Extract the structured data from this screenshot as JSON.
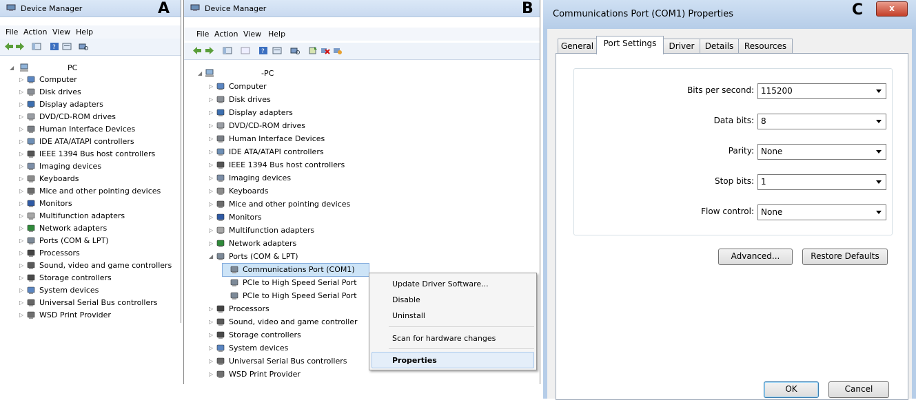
{
  "panelA": {
    "letter": "A",
    "window_title": "Device Manager",
    "menu": [
      "File",
      "Action",
      "View",
      "Help"
    ],
    "root_label": "PC",
    "tree": [
      {
        "label": "Computer",
        "icon": "computer-icon"
      },
      {
        "label": "Disk drives",
        "icon": "disk-drive-icon"
      },
      {
        "label": "Display adapters",
        "icon": "display-adapter-icon"
      },
      {
        "label": "DVD/CD-ROM drives",
        "icon": "dvd-drive-icon"
      },
      {
        "label": "Human Interface Devices",
        "icon": "hid-icon"
      },
      {
        "label": "IDE ATA/ATAPI controllers",
        "icon": "ide-controller-icon"
      },
      {
        "label": "IEEE 1394 Bus host controllers",
        "icon": "ieee1394-icon"
      },
      {
        "label": "Imaging devices",
        "icon": "imaging-device-icon"
      },
      {
        "label": "Keyboards",
        "icon": "keyboard-icon"
      },
      {
        "label": "Mice and other pointing devices",
        "icon": "mouse-icon"
      },
      {
        "label": "Monitors",
        "icon": "monitor-icon"
      },
      {
        "label": "Multifunction adapters",
        "icon": "multifunction-icon"
      },
      {
        "label": "Network adapters",
        "icon": "network-adapter-icon"
      },
      {
        "label": "Ports (COM & LPT)",
        "icon": "port-icon"
      },
      {
        "label": "Processors",
        "icon": "processor-icon"
      },
      {
        "label": "Sound, video and game controllers",
        "icon": "sound-icon"
      },
      {
        "label": "Storage controllers",
        "icon": "storage-controller-icon"
      },
      {
        "label": "System devices",
        "icon": "system-device-icon"
      },
      {
        "label": "Universal Serial Bus controllers",
        "icon": "usb-icon"
      },
      {
        "label": "WSD Print Provider",
        "icon": "printer-icon"
      }
    ]
  },
  "panelB": {
    "letter": "B",
    "window_title": "Device Manager",
    "menu": [
      "File",
      "Action",
      "View",
      "Help"
    ],
    "root_label": "-PC",
    "tree_before": [
      {
        "label": "Computer",
        "icon": "computer-icon"
      },
      {
        "label": "Disk drives",
        "icon": "disk-drive-icon"
      },
      {
        "label": "Display adapters",
        "icon": "display-adapter-icon"
      },
      {
        "label": "DVD/CD-ROM drives",
        "icon": "dvd-drive-icon"
      },
      {
        "label": "Human Interface Devices",
        "icon": "hid-icon"
      },
      {
        "label": "IDE ATA/ATAPI controllers",
        "icon": "ide-controller-icon"
      },
      {
        "label": "IEEE 1394 Bus host controllers",
        "icon": "ieee1394-icon"
      },
      {
        "label": "Imaging devices",
        "icon": "imaging-device-icon"
      },
      {
        "label": "Keyboards",
        "icon": "keyboard-icon"
      },
      {
        "label": "Mice and other pointing devices",
        "icon": "mouse-icon"
      },
      {
        "label": "Monitors",
        "icon": "monitor-icon"
      },
      {
        "label": "Multifunction adapters",
        "icon": "multifunction-icon"
      },
      {
        "label": "Network adapters",
        "icon": "network-adapter-icon"
      },
      {
        "label": "Ports (COM & LPT)",
        "icon": "port-icon"
      }
    ],
    "ports_children": [
      {
        "label": "Communications Port (COM1)"
      },
      {
        "label": "PCIe to High Speed Serial Port"
      },
      {
        "label": "PCIe to High Speed Serial Port"
      }
    ],
    "tree_after": [
      {
        "label": "Processors",
        "icon": "processor-icon"
      },
      {
        "label": "Sound, video and game controller",
        "icon": "sound-icon"
      },
      {
        "label": "Storage controllers",
        "icon": "storage-controller-icon"
      },
      {
        "label": "System devices",
        "icon": "system-device-icon"
      },
      {
        "label": "Universal Serial Bus controllers",
        "icon": "usb-icon"
      },
      {
        "label": "WSD Print Provider",
        "icon": "printer-icon"
      }
    ],
    "context_menu": {
      "update_driver": "Update Driver Software...",
      "disable": "Disable",
      "uninstall": "Uninstall",
      "scan": "Scan for hardware changes",
      "properties": "Properties"
    }
  },
  "panelC": {
    "letter": "C",
    "window_title": "Communications Port (COM1) Properties",
    "close_glyph": "x",
    "tabs": [
      "General",
      "Port Settings",
      "Driver",
      "Details",
      "Resources"
    ],
    "active_tab": "Port Settings",
    "fields": {
      "bits_per_second": {
        "label": "Bits per second:",
        "value": "115200"
      },
      "data_bits": {
        "label": "Data bits:",
        "value": "8"
      },
      "parity": {
        "label": "Parity:",
        "value": "None"
      },
      "stop_bits": {
        "label": "Stop bits:",
        "value": "1"
      },
      "flow_control": {
        "label": "Flow control:",
        "value": "None"
      }
    },
    "advanced_button": "Advanced...",
    "restore_button": "Restore Defaults",
    "ok_button": "OK",
    "cancel_button": "Cancel"
  }
}
